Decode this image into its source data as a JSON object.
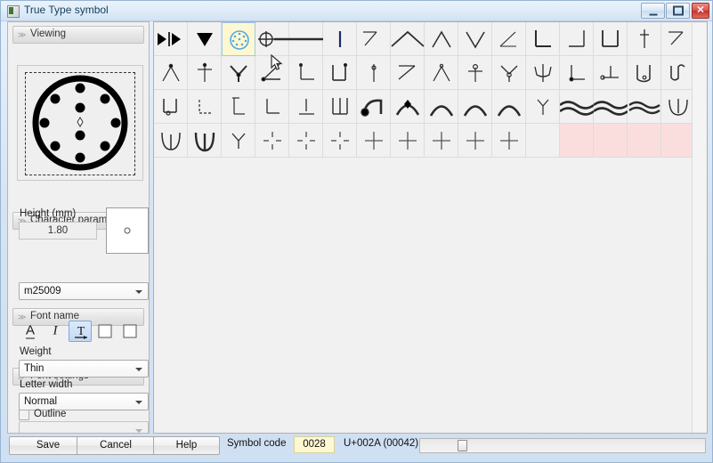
{
  "window": {
    "title": "True Type symbol",
    "app_icon": "app-icon",
    "minimize_label": "",
    "maximize_label": "",
    "close_label": "✕"
  },
  "sidebar": {
    "groups": [
      {
        "label": "Viewing",
        "chevron": "≫"
      },
      {
        "label": "Character parameters",
        "chevron": "≫"
      },
      {
        "label": "Font name",
        "chevron": "≫"
      },
      {
        "label": "Font settings",
        "chevron": "≫"
      }
    ],
    "character_parameters": {
      "height_label": "Height (mm)",
      "height_value": "1.80"
    },
    "font_name": {
      "value": "m25009"
    },
    "font_settings": {
      "style_buttons": [
        {
          "name": "underline",
          "glyph": "A",
          "selected": false
        },
        {
          "name": "italic",
          "glyph": "I",
          "selected": false
        },
        {
          "name": "text-arrow",
          "glyph": "T",
          "selected": true
        },
        {
          "name": "box-1",
          "glyph": "",
          "selected": false
        },
        {
          "name": "box-2",
          "glyph": "",
          "selected": false
        }
      ],
      "weight_label": "Weight",
      "weight_value": "Thin",
      "letter_width_label": "Letter width",
      "letter_width_value": "Normal",
      "outline_label": "Outline",
      "outline_checked": false,
      "outline_style_value": ""
    }
  },
  "bottom": {
    "save_label": "Save",
    "cancel_label": "Cancel",
    "help_label": "Help",
    "symbol_code_label": "Symbol code",
    "symbol_code_value": "0028",
    "unicode_label": "U+002A (00042)"
  },
  "colors": {
    "selection_bg": "#fdf8d2",
    "selection_border": "#9fc6e8",
    "pink_cell": "#fadede",
    "panel_bg": "#f1f1f1",
    "accent_blue": "#7da7d9"
  },
  "grid": {
    "columns": 16,
    "rows": 4,
    "selected_index": 2,
    "cells": [
      {
        "name": "left-right-triangles",
        "shape": "triangles-lr",
        "state": "normal"
      },
      {
        "name": "triangle-down",
        "shape": "triangle-down",
        "state": "normal"
      },
      {
        "name": "dotted-circle",
        "shape": "dotted-circle",
        "state": "selected"
      },
      {
        "name": "crossed-circle-line",
        "shape": "crossed-circle",
        "state": "normal"
      },
      {
        "name": "horizontal-line",
        "shape": "hline",
        "state": "normal"
      },
      {
        "name": "vertical-bar",
        "shape": "vbar",
        "state": "normal"
      },
      {
        "name": "corner-diagonal",
        "shape": "corner-diag",
        "state": "normal"
      },
      {
        "name": "chevron-up-wide",
        "shape": "chevron-wide",
        "state": "normal"
      },
      {
        "name": "caret-up",
        "shape": "caret-up",
        "state": "normal"
      },
      {
        "name": "caret-down",
        "shape": "caret-down",
        "state": "normal"
      },
      {
        "name": "angle-left",
        "shape": "angle",
        "state": "normal"
      },
      {
        "name": "corner-bottom-left",
        "shape": "corner-bl",
        "state": "normal"
      },
      {
        "name": "corner-bottom-right",
        "shape": "corner-br",
        "state": "normal"
      },
      {
        "name": "u-bracket",
        "shape": "u-bracket",
        "state": "normal"
      },
      {
        "name": "vertical-tick",
        "shape": "vtick",
        "state": "normal"
      },
      {
        "name": "diagonal-flag",
        "shape": "diag-flag",
        "state": "normal"
      },
      {
        "name": "caret-a",
        "shape": "caret-a",
        "state": "normal"
      },
      {
        "name": "cross-t",
        "shape": "cross-t",
        "state": "normal"
      },
      {
        "name": "y-bold",
        "shape": "y-bold",
        "state": "normal"
      },
      {
        "name": "diagonal-dot",
        "shape": "diag-dot",
        "state": "normal"
      },
      {
        "name": "corner-l",
        "shape": "corner-l",
        "state": "normal"
      },
      {
        "name": "u-tick",
        "shape": "u-tick",
        "state": "normal"
      },
      {
        "name": "vline-dot",
        "shape": "vline-dot",
        "state": "normal"
      },
      {
        "name": "diag-back",
        "shape": "diag-back",
        "state": "normal"
      },
      {
        "name": "caret-open",
        "shape": "caret-open",
        "state": "normal"
      },
      {
        "name": "t-circle",
        "shape": "t-circle",
        "state": "normal"
      },
      {
        "name": "y-circle",
        "shape": "y-circle",
        "state": "normal"
      },
      {
        "name": "psi",
        "shape": "psi",
        "state": "normal"
      },
      {
        "name": "l-dot",
        "shape": "l-dot",
        "state": "normal"
      },
      {
        "name": "l-flat-dot",
        "shape": "l-flat-dot",
        "state": "normal"
      },
      {
        "name": "u-dot",
        "shape": "u-dot",
        "state": "normal"
      },
      {
        "name": "u-hook",
        "shape": "u-hook",
        "state": "normal"
      },
      {
        "name": "u-bracket-dot",
        "shape": "u-bracket-dot",
        "state": "normal"
      },
      {
        "name": "dotted-corner",
        "shape": "dotted-corner",
        "state": "normal"
      },
      {
        "name": "corner-tall",
        "shape": "corner-tall",
        "state": "normal"
      },
      {
        "name": "corner-plain",
        "shape": "corner-plain",
        "state": "normal"
      },
      {
        "name": "corner-underline",
        "shape": "corner-under",
        "state": "normal"
      },
      {
        "name": "double-u",
        "shape": "double-u",
        "state": "normal"
      },
      {
        "name": "arc-dot-left",
        "shape": "arc-dot-left",
        "state": "normal"
      },
      {
        "name": "arc-dot-center",
        "shape": "arc-dot-center",
        "state": "normal"
      },
      {
        "name": "arc-plain-1",
        "shape": "arc-plain",
        "state": "normal"
      },
      {
        "name": "arc-plain-2",
        "shape": "arc-plain",
        "state": "normal"
      },
      {
        "name": "arc-plain-3",
        "shape": "arc-plain",
        "state": "normal"
      },
      {
        "name": "y-small",
        "shape": "y-small",
        "state": "normal"
      },
      {
        "name": "wave-1",
        "shape": "wave",
        "state": "normal"
      },
      {
        "name": "wave-2",
        "shape": "wave",
        "state": "normal"
      },
      {
        "name": "wave-3",
        "shape": "wave-small",
        "state": "normal"
      },
      {
        "name": "psi-arc",
        "shape": "psi-arc",
        "state": "normal"
      },
      {
        "name": "u-psi-1",
        "shape": "u-psi",
        "state": "normal"
      },
      {
        "name": "u-psi-2",
        "shape": "u-psi-bold",
        "state": "normal"
      },
      {
        "name": "y-plain",
        "shape": "y-plain",
        "state": "normal"
      },
      {
        "name": "cross-dashed-1",
        "shape": "cross-dashed",
        "state": "normal"
      },
      {
        "name": "cross-dashed-2",
        "shape": "cross-dashed",
        "state": "normal"
      },
      {
        "name": "cross-dashed-3",
        "shape": "cross-dashed",
        "state": "normal"
      },
      {
        "name": "cross-plain-1",
        "shape": "cross-plain",
        "state": "normal"
      },
      {
        "name": "cross-plain-2",
        "shape": "cross-plain",
        "state": "normal"
      },
      {
        "name": "cross-plain-3",
        "shape": "cross-plain",
        "state": "normal"
      },
      {
        "name": "cross-plain-4",
        "shape": "cross-plain",
        "state": "normal"
      },
      {
        "name": "cross-plain-5",
        "shape": "cross-plain",
        "state": "normal"
      },
      {
        "name": "empty-cell",
        "shape": "none",
        "state": "normal"
      },
      {
        "name": "reserved-cell-1",
        "shape": "none",
        "state": "pink"
      },
      {
        "name": "reserved-cell-2",
        "shape": "none",
        "state": "pink"
      },
      {
        "name": "reserved-cell-3",
        "shape": "none",
        "state": "pink"
      },
      {
        "name": "reserved-cell-4",
        "shape": "none",
        "state": "pink"
      }
    ]
  },
  "preview": {
    "name": "symbol-preview",
    "description": "thick circle with ten dots"
  }
}
